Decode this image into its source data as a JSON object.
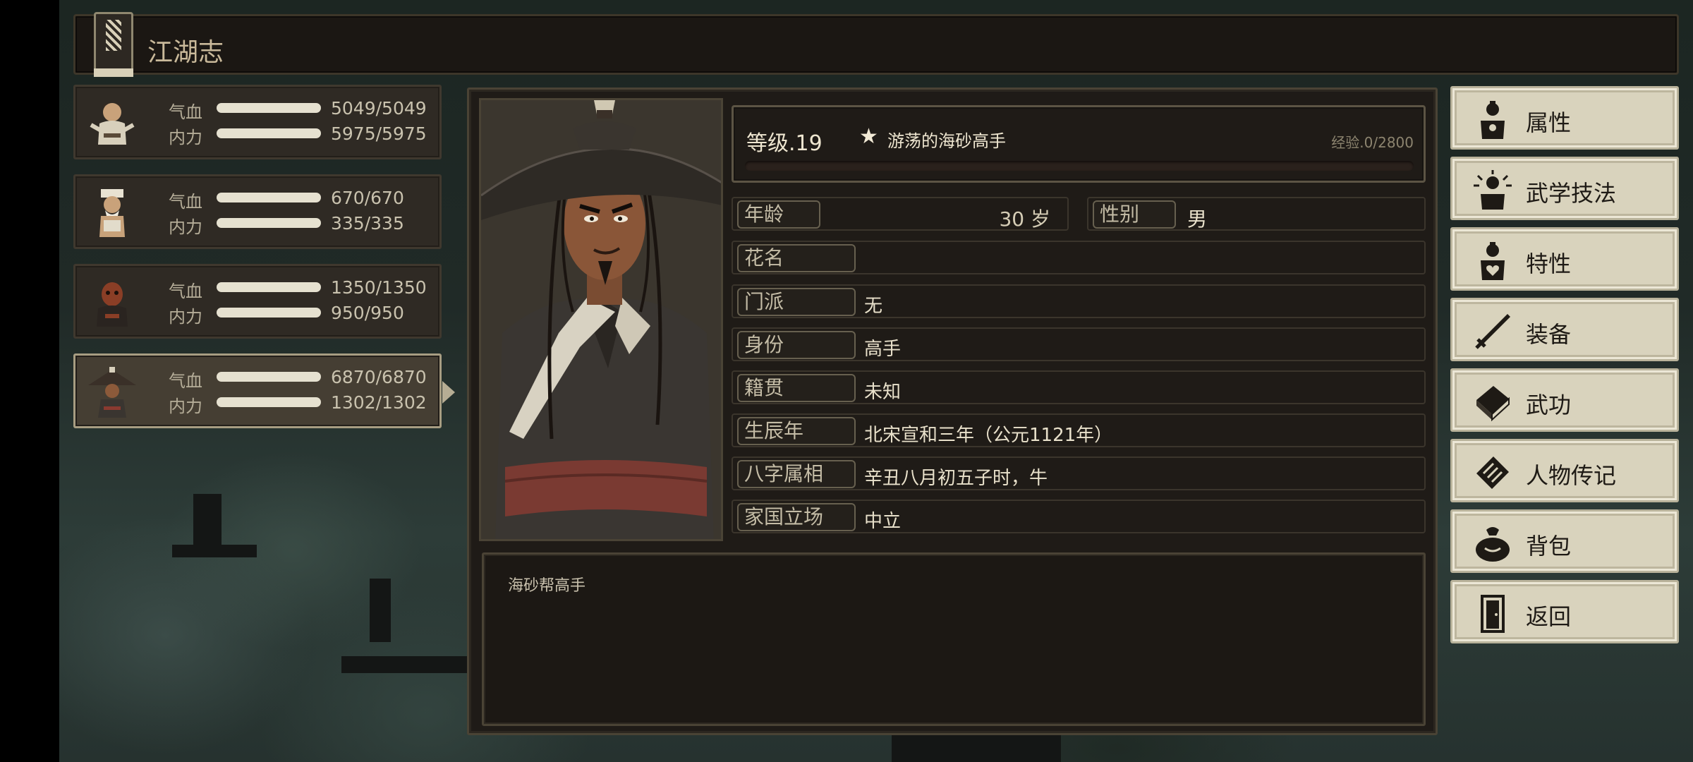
{
  "header": {
    "title": "江湖志"
  },
  "party": [
    {
      "hp_label": "气血",
      "hp": "5049/5049",
      "mp_label": "内力",
      "mp": "5975/5975"
    },
    {
      "hp_label": "气血",
      "hp": "670/670",
      "mp_label": "内力",
      "mp": "335/335"
    },
    {
      "hp_label": "气血",
      "hp": "1350/1350",
      "mp_label": "内力",
      "mp": "950/950"
    },
    {
      "hp_label": "气血",
      "hp": "6870/6870",
      "mp_label": "内力",
      "mp": "1302/1302",
      "selected": true
    }
  ],
  "character": {
    "level": "等级.19",
    "star": "★",
    "rank": "游荡的海砂高手",
    "exp": "经验.0/2800",
    "exp_fraction": 0,
    "age_label": "年龄",
    "age_value": "30 岁",
    "gender_label": "性别",
    "gender_value": "男",
    "fields": [
      {
        "label": "花名",
        "value": ""
      },
      {
        "label": "门派",
        "value": "无"
      },
      {
        "label": "身份",
        "value": "高手"
      },
      {
        "label": "籍贯",
        "value": "未知"
      },
      {
        "label": "生辰年",
        "value": "北宋宣和三年（公元1121年）"
      },
      {
        "label": "八字属相",
        "value": "辛丑八月初五子时，牛"
      },
      {
        "label": "家国立场",
        "value": "中立"
      }
    ],
    "bio": "海砂帮高手"
  },
  "menu": [
    {
      "label": "属性",
      "icon": "person-icon"
    },
    {
      "label": "武学技法",
      "icon": "sparkle-person-icon"
    },
    {
      "label": "特性",
      "icon": "heart-person-icon"
    },
    {
      "label": "装备",
      "icon": "sword-icon"
    },
    {
      "label": "武功",
      "icon": "manual-book-icon"
    },
    {
      "label": "人物传记",
      "icon": "scroll-icon"
    },
    {
      "label": "背包",
      "icon": "bag-icon"
    },
    {
      "label": "返回",
      "icon": "door-icon"
    }
  ]
}
